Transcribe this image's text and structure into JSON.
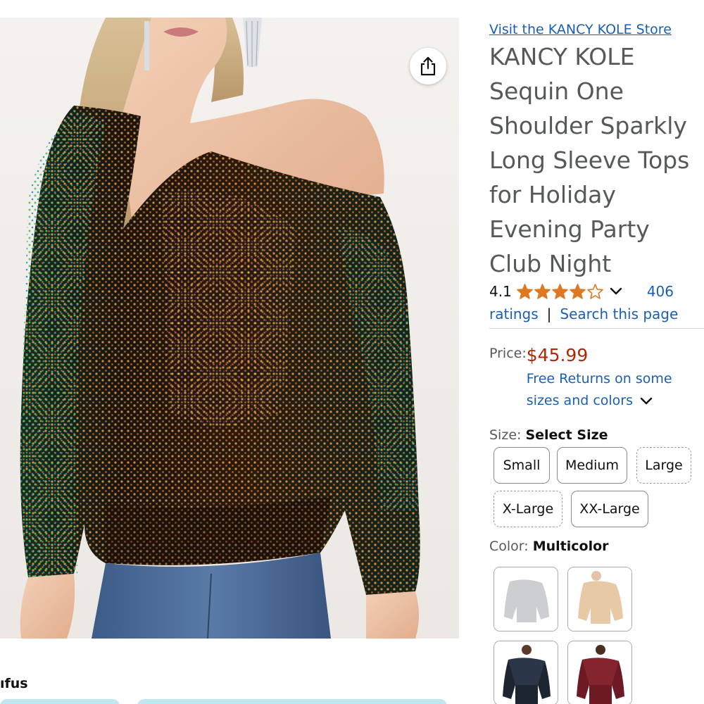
{
  "store_link": "Visit the KANCY KOLE Store",
  "title": "KANCY KOLE Sequin One Shoulder Sparkly Long Sleeve Tops for Holiday Evening Party Club Night",
  "rating": {
    "value": "4.1",
    "stars": 4.1,
    "count": "406",
    "count_suffix": "ratings",
    "separator": "|",
    "search_link": "Search this page"
  },
  "price": {
    "label": "Price:",
    "amount": "$45.99",
    "returns": "Free Returns on some sizes and colors"
  },
  "size": {
    "label": "Size:",
    "selected": "Select Size",
    "options": [
      "Small",
      "Medium",
      "Large",
      "X-Large",
      "XX-Large"
    ]
  },
  "color": {
    "label": "Color:",
    "selected": "Multicolor",
    "swatches": [
      "silver",
      "champagne",
      "black",
      "wine-red"
    ]
  },
  "partial_text": "ıfus",
  "icons": {
    "share": "share-icon",
    "chevron": "chevron-down-icon",
    "star": "star-icon"
  },
  "colors": {
    "link": "#1a5fb4",
    "price": "#b12704",
    "star": "#de7921",
    "title": "#565959"
  }
}
